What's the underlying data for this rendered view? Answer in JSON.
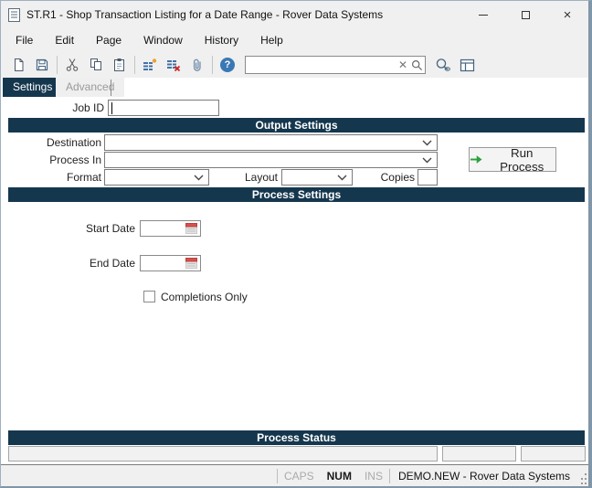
{
  "window": {
    "title": "ST.R1 - Shop Transaction Listing for a Date Range - Rover Data Systems",
    "controls": {
      "minimize": "minimize",
      "maximize": "maximize",
      "close": "×"
    }
  },
  "menu": {
    "items": [
      "File",
      "Edit",
      "Page",
      "Window",
      "History",
      "Help"
    ]
  },
  "toolbar": {
    "icons": [
      "new-document-icon",
      "save-icon",
      "cut-icon",
      "copy-icon",
      "paste-icon",
      "insert-rows-icon",
      "delete-rows-icon",
      "attachment-icon",
      "help-icon",
      "clear-search-icon",
      "search-icon",
      "lookup-icon",
      "layout-icon"
    ],
    "help_glyph": "?",
    "search": {
      "value": "",
      "placeholder": "",
      "clear_glyph": "✕"
    }
  },
  "tabs": {
    "settings": {
      "label": "Settings",
      "active": true
    },
    "advanced": {
      "label": "Advanced",
      "active": false
    }
  },
  "form": {
    "job_id": {
      "label": "Job ID",
      "value": ""
    },
    "sections": {
      "output_settings": "Output Settings",
      "process_settings": "Process Settings",
      "process_status": "Process Status"
    },
    "destination": {
      "label": "Destination",
      "value": ""
    },
    "process_in": {
      "label": "Process In",
      "value": ""
    },
    "format": {
      "label": "Format",
      "value": ""
    },
    "layout": {
      "label": "Layout",
      "value": ""
    },
    "copies": {
      "label": "Copies",
      "value": ""
    },
    "run_button": {
      "label": "Run Process"
    },
    "start_date": {
      "label": "Start Date",
      "value": ""
    },
    "end_date": {
      "label": "End Date",
      "value": ""
    },
    "completions_only": {
      "label": "Completions Only",
      "checked": false
    }
  },
  "status_bar": {
    "caps": "CAPS",
    "num": "NUM",
    "ins": "INS",
    "session": "DEMO.NEW - Rover Data Systems"
  },
  "colors": {
    "navy": "#15374e",
    "chrome": "#f0f0f0",
    "icon_blue": "#44637f",
    "accent_blue": "#3a78b5",
    "green": "#2ca03c",
    "calendar_red": "#d6514d",
    "border_blue": "#8096a9"
  }
}
